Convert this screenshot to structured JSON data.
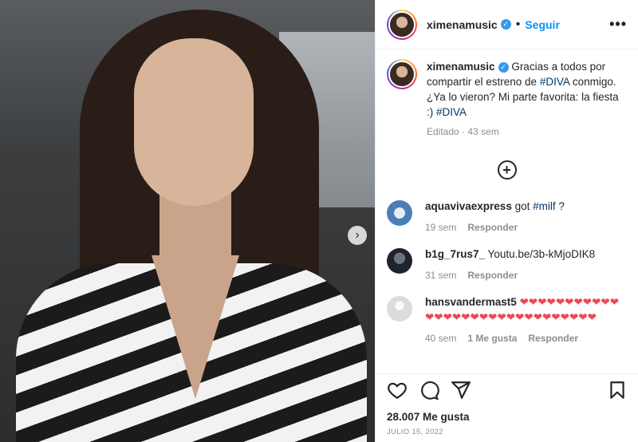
{
  "post": {
    "username": "ximenamusic",
    "follow_label": "Seguir",
    "dot": "•",
    "more_label": "•••",
    "caption_before": "Gracias a todos por compartir el estreno de ",
    "caption_tag1": "#DIVA",
    "caption_middle": " conmigo. ¿Ya lo vieron? Mi parte favorita: la fiesta :) ",
    "caption_tag2": "#DIVA",
    "caption_meta": "Editado · 43 sem",
    "likes": "28.007 Me gusta",
    "date": "JULIO 15, 2022"
  },
  "comments": [
    {
      "username": "aquavivaexpress",
      "text_before": " got ",
      "tag": "#milf",
      "text_after": " ?",
      "time": "19 sem",
      "reply_label": "Responder",
      "avatar_color": "#4a7fb5"
    },
    {
      "username": "b1g_7rus7_",
      "text_before": " Youtu.be/3b-kMjoDIK8",
      "time": "31 sem",
      "reply_label": "Responder",
      "avatar_color": "#2a2f3a"
    },
    {
      "username": "hansvandermast5",
      "hearts": "❤❤❤❤❤❤❤❤❤❤❤❤❤❤❤❤❤❤❤❤❤❤❤❤❤❤❤❤❤❤",
      "time": "40 sem",
      "likes": "1 Me gusta",
      "reply_label": "Responder",
      "avatar_color": "#dcdcdc"
    }
  ],
  "icons": {
    "carousel_next": "›",
    "verified": "✓",
    "load_more": "+"
  },
  "colors": {
    "accent": "#0095f6",
    "hashtag": "#00376b",
    "heart": "#ed4956"
  }
}
